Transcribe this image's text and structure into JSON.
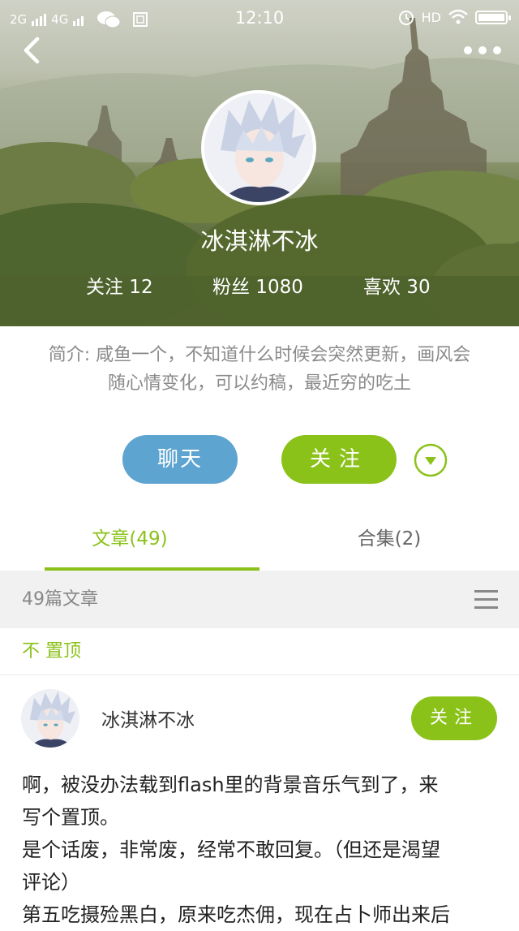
{
  "status_bar": {
    "network_1": "2G",
    "network_2": "4G",
    "time": "12:10",
    "hd_label": "HD",
    "icons": [
      "signal-icon",
      "wechat-icon",
      "sim-icon",
      "alarm-icon",
      "wifi-icon",
      "battery-icon"
    ]
  },
  "header": {
    "back_icon": "back-icon",
    "more_icon": "more-dots-icon"
  },
  "profile": {
    "nickname": "冰淇淋不冰",
    "stats": {
      "following": "关注 12",
      "fans": "粉丝 1080",
      "likes": "喜欢 30"
    },
    "intro_line1": "简介: 咸鱼一个，不知道什么时候会突然更新，画风会",
    "intro_line2": "随心情变化，可以约稿，最近穷的吃土"
  },
  "actions": {
    "chat_label": "聊天",
    "follow_label": "关注",
    "dropdown_icon": "triangle-down-icon"
  },
  "tabs": [
    {
      "label": "文章(49)",
      "active": true
    },
    {
      "label": "合集(2)",
      "active": false
    }
  ],
  "list_header": {
    "count_label": "49篇文章",
    "menu_icon": "menu-icon"
  },
  "pinned": {
    "label": "不 置顶"
  },
  "post": {
    "author": "冰淇淋不冰",
    "follow_label": "关注",
    "lines": [
      "啊，被没办法载到flash里的背景音乐气到了，来",
      "写个置顶。",
      "是个话废，非常废，经常不敢回复。（但还是渴望",
      "评论）",
      "第五吃摄殓黑白，原来吃杰佣，现在占卜师出来后"
    ]
  },
  "colors": {
    "accent_green": "#8bc21a",
    "chat_blue": "#5da4d0",
    "subbar_gray": "#f1f1f1"
  }
}
